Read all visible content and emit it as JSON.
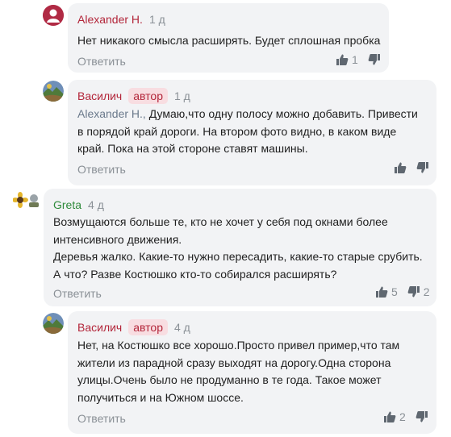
{
  "colors": {
    "bubble": "#f2f3f5",
    "author": "#b3263a",
    "author_green": "#2f8a3b",
    "badge_bg": "#f8dde1",
    "muted": "#8a9096",
    "icon": "#5f6770"
  },
  "comments": [
    {
      "author": "Alexander H.",
      "badge": "",
      "date": "1 д",
      "avatar_icon": "user-avatar-icon",
      "text": "Нет никакого смысла расширять. Будет сплошная пробка",
      "reply": "Ответить",
      "likes": "1",
      "dislikes": ""
    },
    {
      "author": "Василич",
      "badge": "автор",
      "date": "1 д",
      "avatar_icon": "landscape-avatar-icon",
      "mention": "Alexander H.,",
      "text_first_line": " Думаю,что одну полосу можно добавить. Привести",
      "text_rest": "в порядой край дороги. На  втором фото видно, в каком виде\nкрай. Пока на этой стороне ставят машины.",
      "reply": "Ответить",
      "likes": "",
      "dislikes": ""
    },
    {
      "author": "Greta",
      "badge": "",
      "date": "4 д",
      "avatar_icon": "sunflower-avatar-icon",
      "text": "Возмущаются больше те, кто не хочет у себя под окнами более\nинтенсивного движения.\nДеревья жалко. Какие-то нужно пересадить, какие-то старые срубить.\nА что? Разве Костюшко кто-то собирался расширять?",
      "reply": "Ответить",
      "likes": "5",
      "dislikes": "2"
    },
    {
      "author": "Василич",
      "badge": "автор",
      "date": "4 д",
      "avatar_icon": "landscape-avatar-icon",
      "text": "Нет, на Костюшко все хорошо.Просто привел пример,что там\nжители из парадной сразу выходят на дорогу.Одна сторона\nулицы.Очень было не продуманно в те года. Такое может\nполучиться и на Южном шоссе.",
      "reply": "Ответить",
      "likes": "2",
      "dislikes": ""
    }
  ]
}
